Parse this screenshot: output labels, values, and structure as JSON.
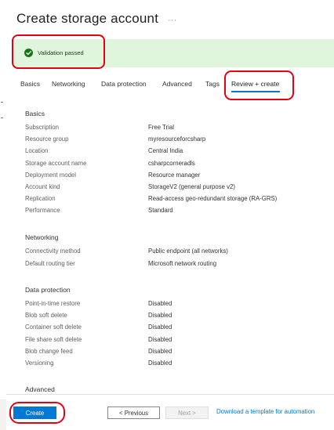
{
  "page": {
    "title": "Create storage account",
    "title_more": "···"
  },
  "validation": {
    "text": "Validation passed",
    "status_color": "#107c10",
    "bg_color": "#dff6dd"
  },
  "tabs": [
    {
      "label": "Basics"
    },
    {
      "label": "Networking"
    },
    {
      "label": "Data protection"
    },
    {
      "label": "Advanced"
    },
    {
      "label": "Tags"
    },
    {
      "label": "Review + create",
      "active": true
    }
  ],
  "sections": {
    "basics": {
      "title": "Basics",
      "rows": [
        {
          "key": "Subscription",
          "value": "Free Trial"
        },
        {
          "key": "Resource group",
          "value": "myresourceforcsharp"
        },
        {
          "key": "Location",
          "value": "Central India"
        },
        {
          "key": "Storage account name",
          "value": "csharpcorneradls"
        },
        {
          "key": "Deployment model",
          "value": "Resource manager"
        },
        {
          "key": "Account kind",
          "value": "StorageV2 (general purpose v2)"
        },
        {
          "key": "Replication",
          "value": "Read-access geo-redundant storage (RA-GRS)"
        },
        {
          "key": "Performance",
          "value": "Standard"
        }
      ]
    },
    "networking": {
      "title": "Networking",
      "rows": [
        {
          "key": "Connectivity method",
          "value": "Public endpoint (all networks)"
        },
        {
          "key": "Default routing tier",
          "value": "Microsoft network routing"
        }
      ]
    },
    "data_protection": {
      "title": "Data protection",
      "rows": [
        {
          "key": "Point-in-time restore",
          "value": "Disabled"
        },
        {
          "key": "Blob soft delete",
          "value": "Disabled"
        },
        {
          "key": "Container soft delete",
          "value": "Disabled"
        },
        {
          "key": "File share soft delete",
          "value": "Disabled"
        },
        {
          "key": "Blob change feed",
          "value": "Disabled"
        },
        {
          "key": "Versioning",
          "value": "Disabled"
        }
      ]
    },
    "advanced": {
      "title": "Advanced"
    }
  },
  "footer": {
    "create_label": "Create",
    "previous_label": "< Previous",
    "next_label": "Next >",
    "download_label": "Download a template for automation"
  },
  "colors": {
    "accent": "#0078d4",
    "annotation": "#e60012"
  }
}
